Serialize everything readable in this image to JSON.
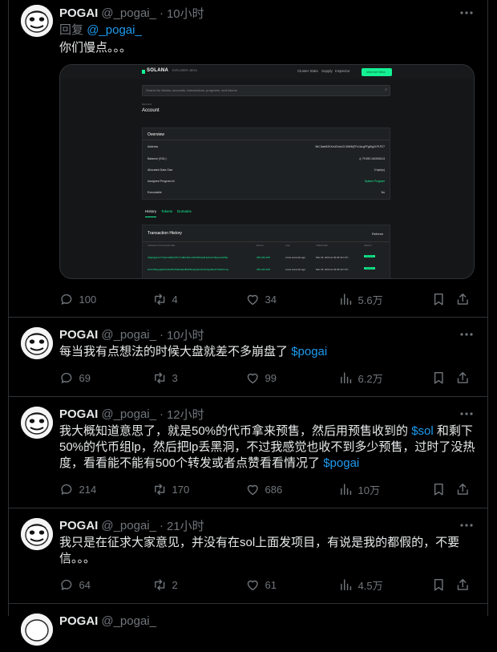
{
  "tweets": [
    {
      "name": "POGAI",
      "handle": "@_pogai_",
      "time": "10小时",
      "reply_prefix": "回复",
      "reply_handle": "@_pogai_",
      "text": "你们慢点。。。",
      "replies": "100",
      "retweets": "4",
      "likes": "34",
      "views": "5.6万"
    },
    {
      "name": "POGAI",
      "handle": "@_pogai_",
      "time": "10小时",
      "text": "每当我有点想法的时候大盘就差不多崩盘了",
      "link": "$pogai",
      "replies": "69",
      "retweets": "3",
      "likes": "99",
      "views": "6.2万"
    },
    {
      "name": "POGAI",
      "handle": "@_pogai_",
      "time": "12小时",
      "text_part1": "我大概知道意思了，就是50%的代币拿来预售，然后用预售收到的",
      "link1": "$sol",
      "text_part2": "和剩下50%的代币组lp，然后把lp丢黑洞，不过我感觉也收不到多少预售，过时了没热度，看看能不能有500个转发或者点赞看看情况了",
      "link2": "$pogai",
      "replies": "214",
      "retweets": "170",
      "likes": "686",
      "views": "10万"
    },
    {
      "name": "POGAI",
      "handle": "@_pogai_",
      "time": "21小时",
      "text": "我只是在征求大家意见，并没有在sol上面发项目，有说是我的都假的，不要信。。。",
      "replies": "64",
      "retweets": "2",
      "likes": "61",
      "views": "4.5万"
    },
    {
      "name": "POGAI",
      "handle": "@_pogai_",
      "time": ""
    }
  ],
  "screenshot": {
    "brand": "SOLANA",
    "brand_sub": "EXPLORER / BETA",
    "nav": [
      "Cluster Stats",
      "Supply",
      "Inspector"
    ],
    "network_button": "Mainnet Beta",
    "search_placeholder": "Search for blocks, accounts, transactions, programs, and tokens",
    "pretitle": "DETAILS",
    "title": "Account",
    "overview_header": "Overview",
    "rows": [
      {
        "label": "Address",
        "value": "5bC3aeM2KXm1EcdxCCMWMj7Fc1AzgFFgWg2LP1PZ7"
      },
      {
        "label": "Balance (SOL)",
        "value": "◎ 79.390.162453413"
      },
      {
        "label": "Allocated Data Size",
        "value": "0 byte(s)"
      },
      {
        "label": "Assigned Program Id",
        "value": "System Program"
      },
      {
        "label": "Executable",
        "value": "No"
      }
    ],
    "tabs": [
      "History",
      "Tokens",
      "Domains"
    ],
    "history_header": "Transaction History",
    "refresh_label": "Refresh",
    "columns": [
      "TRANSACTION SIGNATURE",
      "BLOCK",
      "AGE",
      "TIMESTAMP",
      "RESULT"
    ],
    "tx": [
      {
        "sig": "4xkjpQg1zeY7QemaWbyP4VYxdEC9u1uJL6hhRwpZHwbvxrrNdpvrewM6q",
        "block": "256,345,168",
        "age": "a few seconds ago",
        "ts": "Mar 18, 2024 at 03:29:43 UTC",
        "result": "Success"
      },
      {
        "sig": "2mX4h6wpg9tFbCDuPPHSbKAEwBUP5waQA4U3wVk7geMnxPYaMx1Cuu",
        "block": "256,345,168",
        "age": "a few seconds ago",
        "ts": "Mar 18, 2024 at 03:29:43 UTC",
        "result": "Success"
      }
    ]
  },
  "colors": {
    "background": "#000000",
    "text": "#e7e9ea",
    "muted": "#71767b",
    "link": "#1d9bf0",
    "divider": "#2f3336",
    "solana_green": "#14f195"
  },
  "icons": [
    "avatar-meme-face",
    "more-icon",
    "reply-icon",
    "retweet-icon",
    "like-icon",
    "views-icon",
    "bookmark-icon",
    "share-icon"
  ]
}
